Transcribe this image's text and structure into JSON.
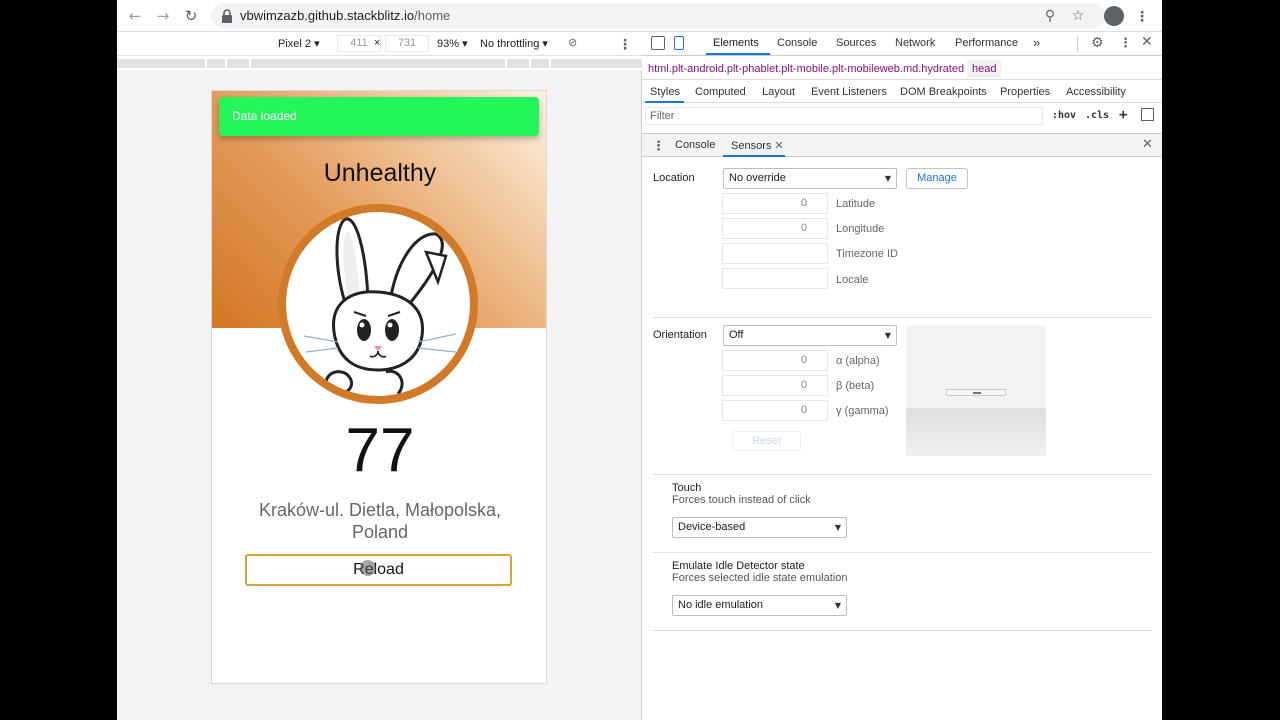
{
  "browser": {
    "url_host": "vbwimzazb.github.stackblitz.io",
    "url_path": "/home"
  },
  "device_toolbar": {
    "device": "Pixel 2",
    "width": "411",
    "times": "×",
    "height": "731",
    "zoom": "93%",
    "throttling": "No throttling"
  },
  "app": {
    "toast": "Data loaded",
    "status": "Unhealthy",
    "aqi_value": "77",
    "location": "Kraków-ul. Dietla, Małopolska, Poland",
    "reload_label": "Reload",
    "accent_color": "#d27a27",
    "toast_color": "#23f55a"
  },
  "devtools": {
    "tabs": [
      "Elements",
      "Console",
      "Sources",
      "Network",
      "Performance"
    ],
    "more_tabs": "»",
    "breadcrumb_html": "html.plt-android.plt-phablet.plt-mobile.plt-mobileweb.md.hydrated",
    "breadcrumb_head": "head",
    "subtabs": [
      "Styles",
      "Computed",
      "Layout",
      "Event Listeners",
      "DOM Breakpoints",
      "Properties",
      "Accessibility"
    ],
    "filter_placeholder": "Filter",
    "hov": ":hov",
    "cls": ".cls",
    "drawer_tabs": [
      "Console",
      "Sensors"
    ]
  },
  "sensors": {
    "location_label": "Location",
    "location_value": "No override",
    "manage_label": "Manage",
    "latitude_value": "0",
    "latitude_label": "Latitude",
    "longitude_value": "0",
    "longitude_label": "Longitude",
    "timezone_label": "Timezone ID",
    "locale_label": "Locale",
    "orientation_label": "Orientation",
    "orientation_value": "Off",
    "alpha_value": "0",
    "alpha_label": "α (alpha)",
    "beta_value": "0",
    "beta_label": "β (beta)",
    "gamma_value": "0",
    "gamma_label": "γ (gamma)",
    "reset_label": "Reset",
    "touch_title": "Touch",
    "touch_desc": "Forces touch instead of click",
    "touch_value": "Device-based",
    "idle_title": "Emulate Idle Detector state",
    "idle_desc": "Forces selected idle state emulation",
    "idle_value": "No idle emulation"
  }
}
